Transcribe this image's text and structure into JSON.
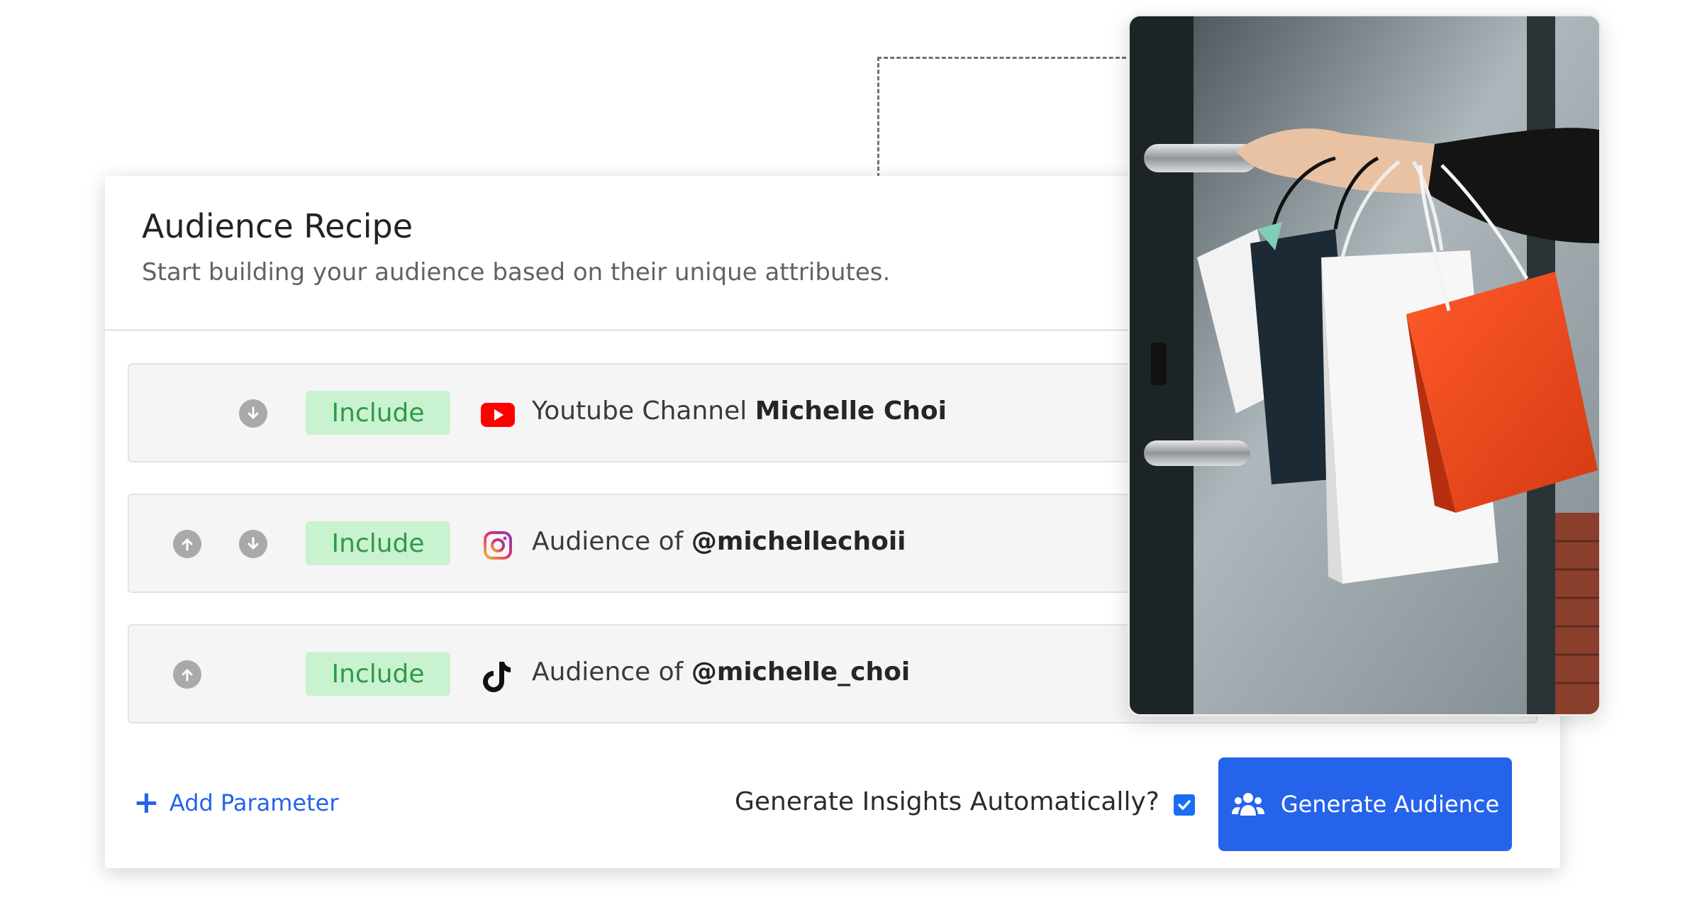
{
  "header": {
    "title": "Audience Recipe",
    "subtitle": "Start building your audience based on their unique attributes."
  },
  "rows": [
    {
      "include_label": "Include",
      "platform_icon": "youtube-icon",
      "prefix": "Youtube Channel",
      "value": "Michelle Choi",
      "arrows": [
        "down"
      ]
    },
    {
      "include_label": "Include",
      "platform_icon": "instagram-icon",
      "prefix": "Audience of",
      "value": "@michellechoii",
      "arrows": [
        "up",
        "down"
      ]
    },
    {
      "include_label": "Include",
      "platform_icon": "tiktok-icon",
      "prefix": "Audience of",
      "value": "@michelle_choi",
      "arrows": [
        "up"
      ]
    }
  ],
  "footer": {
    "add_parameter_label": "Add Parameter",
    "insights_label": "Generate Insights Automatically?",
    "insights_checked": true,
    "generate_button_label": "Generate Audience"
  },
  "colors": {
    "accent_blue": "#2663eb",
    "include_bg": "#c9f2d0",
    "include_text": "#2f9a49"
  }
}
